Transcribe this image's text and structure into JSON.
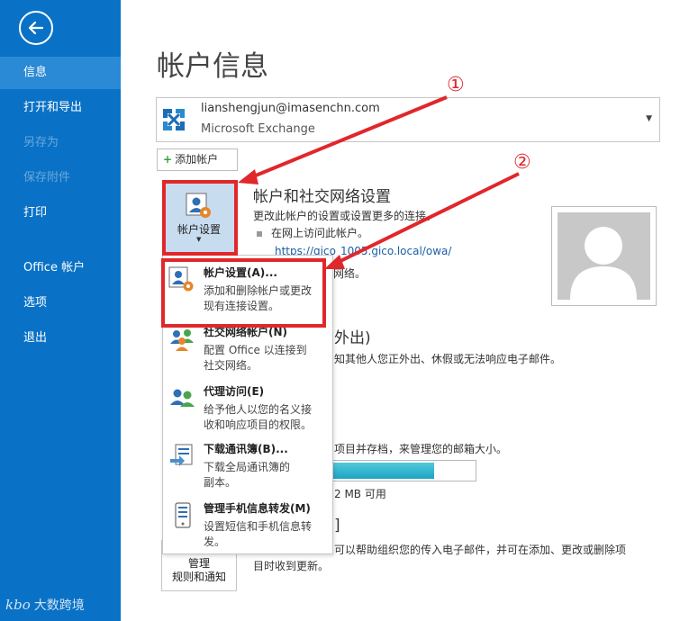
{
  "sidebar": {
    "back_icon": "back-arrow-icon",
    "items": [
      {
        "label": "信息",
        "state": "active"
      },
      {
        "label": "打开和导出",
        "state": "normal"
      },
      {
        "label": "另存为",
        "state": "disabled"
      },
      {
        "label": "保存附件",
        "state": "disabled"
      },
      {
        "label": "打印",
        "state": "normal"
      },
      {
        "label": "Office 帐户",
        "state": "normal"
      },
      {
        "label": "选项",
        "state": "normal"
      },
      {
        "label": "退出",
        "state": "normal"
      }
    ],
    "watermark": "大数跨境",
    "watermark_mark": "kbo",
    "color": "#0a72c6"
  },
  "main": {
    "title": "帐户信息",
    "account": {
      "email": "lianshengjun@imasenchn.com",
      "type": "Microsoft Exchange",
      "icon": "exchange-icon"
    },
    "add_account_label": "添加帐户",
    "account_settings_button": {
      "label": "帐户设置",
      "icon": "account-settings-icon"
    },
    "section_account": {
      "title": "帐户和社交网络设置",
      "desc": "更改此帐户的设置或设置更多的连接。",
      "bullet": "在网上访问此帐户。",
      "link_start": "https://gico",
      "link_end": "1005.gico.local/owa/",
      "partial": "网络。"
    },
    "section_oof": {
      "title_partial": "外出)",
      "desc_partial": "知其他人您正外出、休假或无法响应电子邮件。"
    },
    "section_mailbox": {
      "desc_partial": "项目并存档，来管理您的邮箱大小。",
      "usage_partial": "2 MB 可用",
      "usage_fraction": 0.71
    },
    "section_rules": {
      "title_partial": "]",
      "desc_line1": "可以帮助组织您的传入电子邮件，并可在添加、更改或删除项",
      "desc_line2": "目时收到更新。",
      "manage_label_1": "管理",
      "manage_label_2": "规则和通知"
    },
    "profile_icon": "profile-placeholder-icon"
  },
  "menu": {
    "items": [
      {
        "title": "帐户设置(A)...",
        "desc": [
          "添加和删除帐户或更改",
          "现有连接设置。"
        ],
        "icon": "account-settings-icon"
      },
      {
        "title": "社交网络帐户(N)",
        "desc": [
          "配置 Office 以连接到",
          "社交网络。"
        ],
        "icon": "social-network-icon"
      },
      {
        "title": "代理访问(E)",
        "desc": [
          "给予他人以您的名义接",
          "收和响应项目的权限。"
        ],
        "icon": "delegate-access-icon"
      },
      {
        "title": "下载通讯簿(B)...",
        "desc": [
          "下载全局通讯簿的",
          "副本。"
        ],
        "icon": "download-address-book-icon"
      },
      {
        "title": "管理手机信息转发(M)",
        "desc": [
          "设置短信和手机信息转",
          "发。"
        ],
        "icon": "mobile-alerts-icon"
      }
    ]
  },
  "annotations": {
    "marker_1": "①",
    "marker_2": "②",
    "color": "#e0272b"
  }
}
